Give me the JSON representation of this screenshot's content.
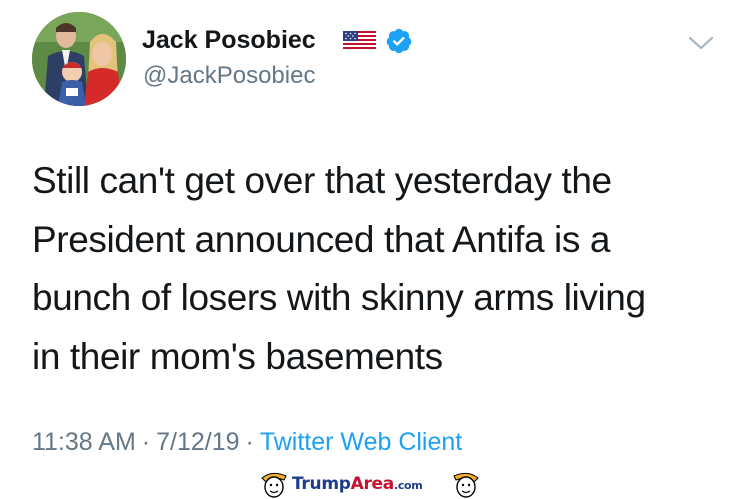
{
  "tweet": {
    "author": {
      "display_name": "Jack Posobiec",
      "handle": "@JackPosobiec",
      "flag_icon": "us-flag-icon",
      "verified_icon": "verified-badge-icon"
    },
    "text": "Still can't get over that yesterday the\nPresident announced that Antifa is a\nbunch of losers with skinny arms living\nin their mom's basements",
    "time": "11:38 AM",
    "separator": "·",
    "date": "7/12/19",
    "source": "Twitter Web Client"
  },
  "watermark": {
    "brand_first": "Trump",
    "brand_second": "Area",
    "suffix": ".com"
  },
  "colors": {
    "text": "#14171a",
    "secondary": "#657786",
    "link": "#1da1f2",
    "verified": "#1da1f2"
  }
}
